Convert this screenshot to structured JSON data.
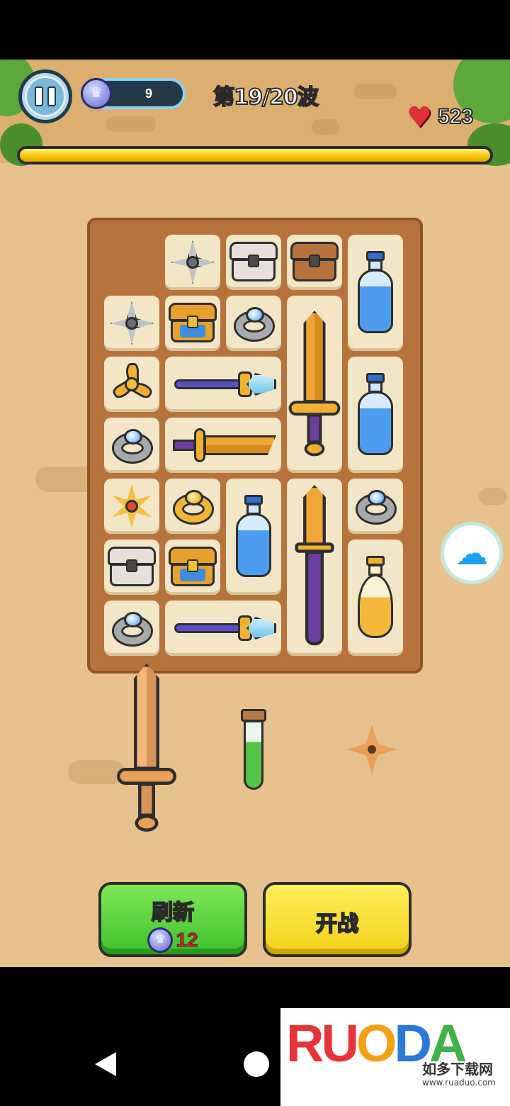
{
  "hud": {
    "gem_count": "9",
    "wave_text": "第19/20波",
    "hp": "523",
    "wave_progress": 1.0
  },
  "board": {
    "items": [
      "shuriken",
      "chest-white",
      "chest-wood",
      "blue-potion",
      "shuriken",
      "chest-blue",
      "ring",
      "golden-sword",
      "fan-star",
      "crystal-staff",
      "blue-potion",
      "ring",
      "dagger",
      "star-shuriken",
      "gold-ring",
      "blue-potion",
      "katana",
      "ring",
      "chest-white",
      "chest-blue",
      "orange-potion",
      "ring",
      "crystal-staff"
    ]
  },
  "pending_items": [
    "bronze-sword",
    "green-potion",
    "bronze-shuriken"
  ],
  "buttons": {
    "refresh_label": "刷新",
    "refresh_cost": "12",
    "fight_label": "开战"
  },
  "watermark": {
    "logo": [
      "R",
      "U",
      "O",
      "D",
      "A",
      "D",
      "U",
      "O"
    ],
    "cn": "如多下载网",
    "url": "www.ruaduo.com"
  },
  "colors": {
    "progress_fill": "#f5c400",
    "refresh_button": "#3fc02c",
    "fight_button": "#f2d21a",
    "board": "#b6733c"
  }
}
